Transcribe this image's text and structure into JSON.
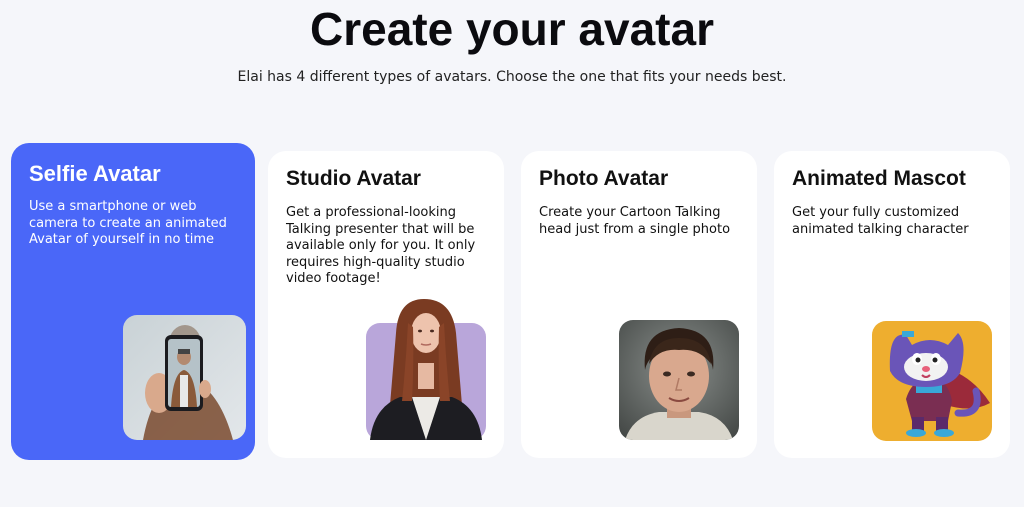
{
  "page": {
    "title": "Create your avatar",
    "subtitle": "Elai has 4 different types of avatars. Choose the one that fits your needs best."
  },
  "cards": [
    {
      "title": "Selfie Avatar",
      "description": "Use a smartphone or web camera to create an animated Avatar of yourself in no time",
      "image": "selfie-phone-photo",
      "active": true
    },
    {
      "title": "Studio Avatar",
      "description": "Get a professional-looking Talking presenter that will be available only for you. It only requires high-quality studio video footage!",
      "image": "studio-presenter-photo",
      "active": false
    },
    {
      "title": "Photo Avatar",
      "description": "Create your Cartoon Talking head just from a single photo",
      "image": "portrait-photo",
      "active": false
    },
    {
      "title": "Animated Mascot",
      "description": "Get your fully customized animated talking character",
      "image": "cat-mascot-illustration",
      "active": false
    }
  ],
  "colors": {
    "background": "#f5f6fa",
    "active_card": "#4a67f8",
    "card": "#ffffff"
  }
}
